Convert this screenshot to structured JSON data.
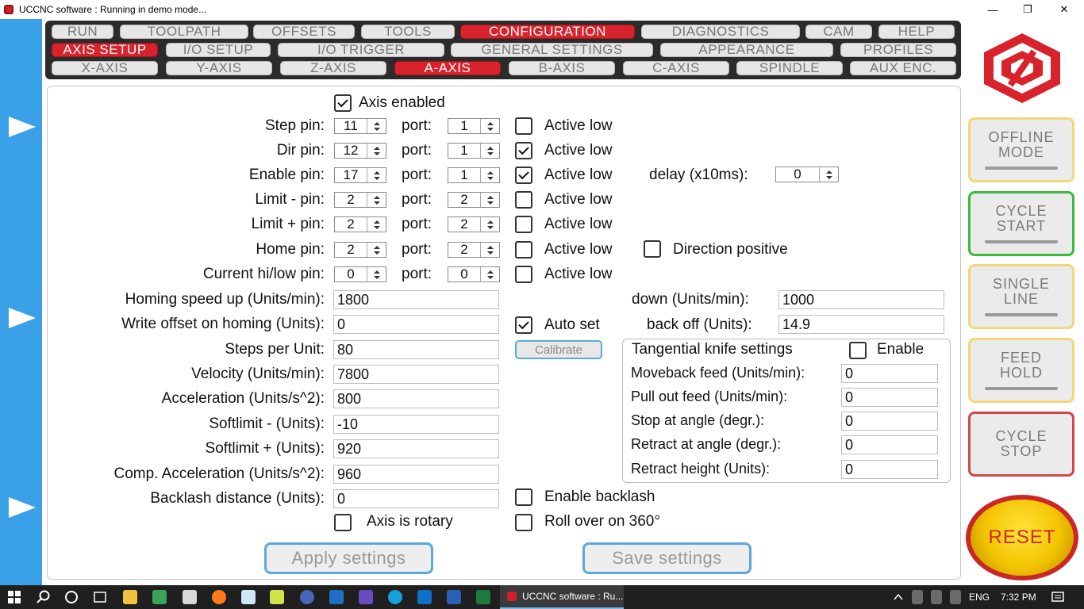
{
  "window": {
    "title": "UCCNC software : Running in demo mode...",
    "minimize": "—",
    "restore": "❐",
    "close": "✕"
  },
  "tabs": {
    "main": [
      "RUN",
      "TOOLPATH",
      "OFFSETS",
      "TOOLS",
      "CONFIGURATION",
      "DIAGNOSTICS",
      "CAM",
      "HELP"
    ],
    "config": [
      "AXIS SETUP",
      "I/O SETUP",
      "I/O TRIGGER",
      "GENERAL SETTINGS",
      "APPEARANCE",
      "PROFILES"
    ],
    "axes": [
      "X-AXIS",
      "Y-AXIS",
      "Z-AXIS",
      "A-AXIS",
      "B-AXIS",
      "C-AXIS",
      "SPINDLE",
      "AUX ENC."
    ],
    "active_main": "CONFIGURATION",
    "active_config": "AXIS SETUP",
    "active_axis": "A-AXIS"
  },
  "axis": {
    "enabled_label": "Axis enabled",
    "enabled": true,
    "port_label": "port:",
    "active_low_label": "Active low",
    "pins": [
      {
        "label": "Step pin:",
        "pin": "11",
        "port": "1",
        "active_low": false
      },
      {
        "label": "Dir pin:",
        "pin": "12",
        "port": "1",
        "active_low": true
      },
      {
        "label": "Enable pin:",
        "pin": "17",
        "port": "1",
        "active_low": true
      },
      {
        "label": "Limit - pin:",
        "pin": "2",
        "port": "2",
        "active_low": false
      },
      {
        "label": "Limit + pin:",
        "pin": "2",
        "port": "2",
        "active_low": false
      },
      {
        "label": "Home pin:",
        "pin": "2",
        "port": "2",
        "active_low": false
      },
      {
        "label": "Current hi/low pin:",
        "pin": "0",
        "port": "0",
        "active_low": false
      }
    ],
    "delay_label": "delay (x10ms):",
    "delay": "0",
    "direction_positive_label": "Direction positive",
    "direction_positive": false,
    "fields": [
      {
        "label": "Homing speed up (Units/min):",
        "value": "1800"
      },
      {
        "label": "Write offset on homing (Units):",
        "value": "0"
      },
      {
        "label": "Steps per Unit:",
        "value": "80"
      },
      {
        "label": "Velocity (Units/min):",
        "value": "7800"
      },
      {
        "label": "Acceleration (Units/s^2):",
        "value": "800"
      },
      {
        "label": "Softlimit - (Units):",
        "value": "-10"
      },
      {
        "label": "Softlimit + (Units):",
        "value": "920"
      },
      {
        "label": "Comp. Acceleration (Units/s^2):",
        "value": "960"
      },
      {
        "label": "Backlash distance (Units):",
        "value": "0"
      }
    ],
    "homing_down_label": "down (Units/min):",
    "homing_down": "1000",
    "auto_set_label": "Auto set",
    "auto_set": true,
    "back_off_label": "back off (Units):",
    "back_off": "14.9",
    "calibrate_label": "Calibrate",
    "enable_backlash_label": "Enable backlash",
    "enable_backlash": false,
    "rotary_label": "Axis is rotary",
    "rotary": false,
    "rollover_label": "Roll over on 360°",
    "rollover": false
  },
  "knife": {
    "title": "Tangential knife settings",
    "enable_label": "Enable",
    "enabled": false,
    "fields": [
      {
        "label": "Moveback feed (Units/min):",
        "value": "0"
      },
      {
        "label": "Pull out feed (Units/min):",
        "value": "0"
      },
      {
        "label": "Stop at angle (degr.):",
        "value": "0"
      },
      {
        "label": "Retract at angle (degr.):",
        "value": "0"
      },
      {
        "label": "Retract height (Units):",
        "value": "0"
      }
    ]
  },
  "buttons": {
    "apply": "Apply settings",
    "save": "Save settings"
  },
  "side": {
    "offline": [
      "OFFLINE",
      "MODE"
    ],
    "cycle_start": [
      "CYCLE",
      "START"
    ],
    "single_line": [
      "SINGLE",
      "LINE"
    ],
    "feed_hold": [
      "FEED",
      "HOLD"
    ],
    "cycle_stop": [
      "CYCLE",
      "STOP"
    ],
    "reset": "RESET"
  },
  "taskbar": {
    "active_app": "UCCNC software : Ru...",
    "lang": "ENG",
    "time": "7:32 PM"
  },
  "colors": {
    "accent_red": "#d8222c",
    "sidebar_blue": "#3aa0e8",
    "button_border_blue": "#5aa8dc",
    "reset_yellow": "#f2c400"
  }
}
